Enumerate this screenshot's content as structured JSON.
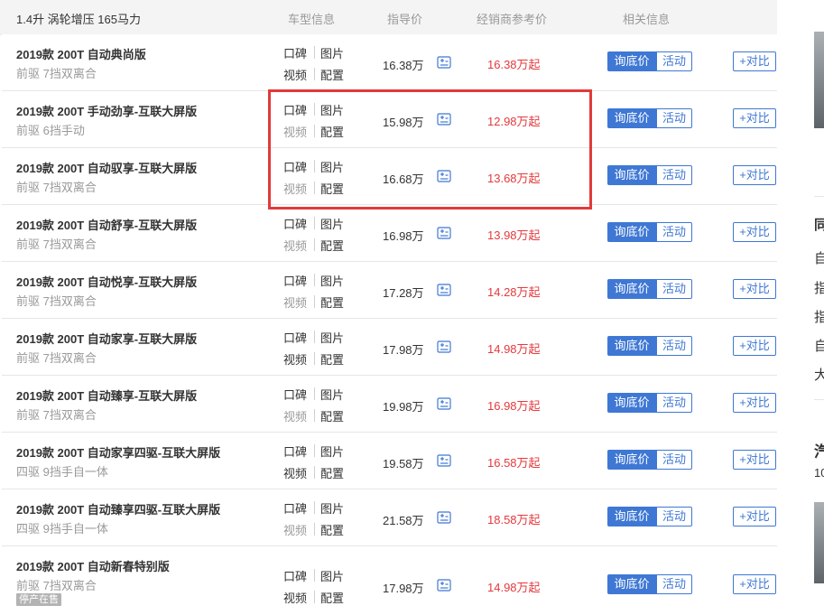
{
  "header": {
    "engine": "1.4升 涡轮增压 165马力",
    "col_info": "车型信息",
    "col_guide": "指导价",
    "col_dealer": "经销商参考价",
    "col_related": "相关信息"
  },
  "labels": {
    "review": "口碑",
    "photos": "图片",
    "video": "视频",
    "config": "配置",
    "ask_price": "询底价",
    "activity": "活动",
    "compare": "+对比",
    "stopped": "停产在售"
  },
  "rows": [
    {
      "name": "2019款 200T 自动典尚版",
      "spec": "前驱 7挡双离合",
      "guide": "16.38万",
      "dealer": "16.38万起",
      "video_active": true,
      "stopped": false
    },
    {
      "name": "2019款 200T 手动劲享-互联大屏版",
      "spec": "前驱 6挡手动",
      "guide": "15.98万",
      "dealer": "12.98万起",
      "video_active": false,
      "stopped": false
    },
    {
      "name": "2019款 200T 自动驭享-互联大屏版",
      "spec": "前驱 7挡双离合",
      "guide": "16.68万",
      "dealer": "13.68万起",
      "video_active": false,
      "stopped": false
    },
    {
      "name": "2019款 200T 自动舒享-互联大屏版",
      "spec": "前驱 7挡双离合",
      "guide": "16.98万",
      "dealer": "13.98万起",
      "video_active": false,
      "stopped": false
    },
    {
      "name": "2019款 200T 自动悦享-互联大屏版",
      "spec": "前驱 7挡双离合",
      "guide": "17.28万",
      "dealer": "14.28万起",
      "video_active": false,
      "stopped": false
    },
    {
      "name": "2019款 200T 自动家享-互联大屏版",
      "spec": "前驱 7挡双离合",
      "guide": "17.98万",
      "dealer": "14.98万起",
      "video_active": true,
      "stopped": false
    },
    {
      "name": "2019款 200T 自动臻享-互联大屏版",
      "spec": "前驱 7挡双离合",
      "guide": "19.98万",
      "dealer": "16.98万起",
      "video_active": false,
      "stopped": false
    },
    {
      "name": "2019款 200T 自动家享四驱-互联大屏版",
      "spec": "四驱 9挡手自一体",
      "guide": "19.58万",
      "dealer": "16.58万起",
      "video_active": true,
      "stopped": false
    },
    {
      "name": "2019款 200T 自动臻享四驱-互联大屏版",
      "spec": "四驱 9挡手自一体",
      "guide": "21.58万",
      "dealer": "18.58万起",
      "video_active": false,
      "stopped": false
    },
    {
      "name": "2019款 200T 自动新春特别版",
      "spec": "前驱 7挡双离合",
      "guide": "17.98万",
      "dealer": "14.98万起",
      "video_active": true,
      "stopped": true
    }
  ],
  "sidebar": {
    "heading1": "同",
    "items": [
      "自",
      "指",
      "指",
      "自",
      "大"
    ],
    "heading2": "汽",
    "subline": "10"
  },
  "colors": {
    "accent": "#3f78d4",
    "price_red": "#e4393c",
    "highlight": "#e23a3a"
  },
  "icons": {
    "calculator": "calculator-icon"
  }
}
